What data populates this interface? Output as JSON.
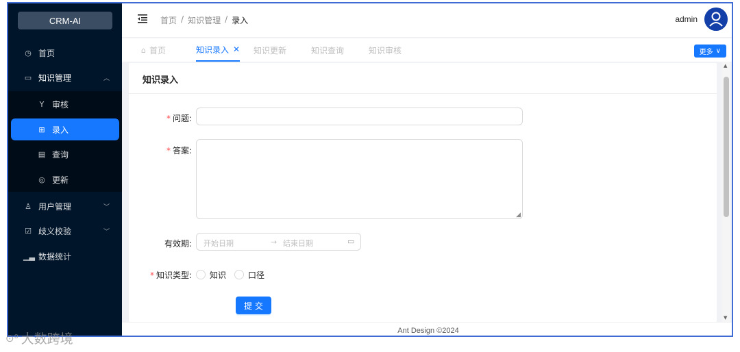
{
  "app": {
    "logo_text": "CRM-AI"
  },
  "sidebar": {
    "items": [
      {
        "label": "首页",
        "icon": "dashboard-icon"
      },
      {
        "label": "知识管理",
        "icon": "desktop-icon"
      },
      {
        "label": "审核",
        "icon": "branch-icon"
      },
      {
        "label": "录入",
        "icon": "table-icon"
      },
      {
        "label": "查询",
        "icon": "file-search-icon"
      },
      {
        "label": "更新",
        "icon": "eye-icon"
      },
      {
        "label": "用户管理",
        "icon": "user-icon"
      },
      {
        "label": "歧义校验",
        "icon": "check-square-icon"
      },
      {
        "label": "数据统计",
        "icon": "bar-chart-icon"
      }
    ]
  },
  "header": {
    "breadcrumb": [
      "首页",
      "知识管理",
      "录入"
    ],
    "separator": "/",
    "username": "admin"
  },
  "tabs": {
    "items": [
      {
        "label": "首页"
      },
      {
        "label": "知识录入"
      },
      {
        "label": "知识更新"
      },
      {
        "label": "知识查询"
      },
      {
        "label": "知识审核"
      }
    ],
    "more_label": "更多"
  },
  "form": {
    "title": "知识录入",
    "question_label": "问题:",
    "answer_label": "答案:",
    "validity_label": "有效期:",
    "start_placeholder": "开始日期",
    "end_placeholder": "结束日期",
    "type_label": "知识类型:",
    "type_options": [
      "知识",
      "口径"
    ],
    "submit_label": "提 交"
  },
  "footer": {
    "text": "Ant Design ©2024"
  },
  "watermark": {
    "text": "大数跨境"
  },
  "colors": {
    "primary": "#1677ff",
    "sidebar_bg": "#001529",
    "submenu_bg": "#000c17",
    "required": "#ff4d4f"
  }
}
